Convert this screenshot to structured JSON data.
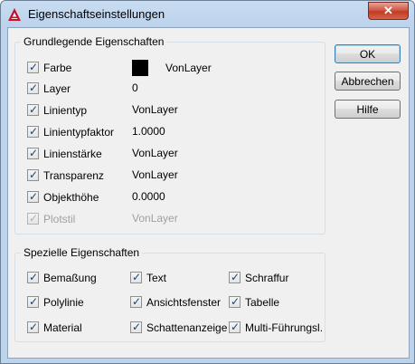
{
  "window": {
    "title": "Eigenschaftseinstellungen",
    "close_symbol": "✕"
  },
  "basic": {
    "title": "Grundlegende Eigenschaften",
    "rows": [
      {
        "label": "Farbe",
        "value": "VonLayer",
        "checked": true,
        "enabled": true
      },
      {
        "label": "Layer",
        "value": "0",
        "checked": true,
        "enabled": true
      },
      {
        "label": "Linientyp",
        "value": "VonLayer",
        "checked": true,
        "enabled": true
      },
      {
        "label": "Linientypfaktor",
        "value": "1.0000",
        "checked": true,
        "enabled": true
      },
      {
        "label": "Linienstärke",
        "value": "VonLayer",
        "checked": true,
        "enabled": true
      },
      {
        "label": "Transparenz",
        "value": "VonLayer",
        "checked": true,
        "enabled": true
      },
      {
        "label": "Objekthöhe",
        "value": "0.0000",
        "checked": true,
        "enabled": true
      },
      {
        "label": "Plotstil",
        "value": "VonLayer",
        "checked": true,
        "enabled": false
      }
    ],
    "color_swatch": "#000000"
  },
  "special": {
    "title": "Spezielle Eigenschaften",
    "items": [
      {
        "label": "Bemaßung",
        "checked": true
      },
      {
        "label": "Text",
        "checked": true
      },
      {
        "label": "Schraffur",
        "checked": true
      },
      {
        "label": "Polylinie",
        "checked": true
      },
      {
        "label": "Ansichtsfenster",
        "checked": true
      },
      {
        "label": "Tabelle",
        "checked": true
      },
      {
        "label": "Material",
        "checked": true
      },
      {
        "label": "Schattenanzeige",
        "checked": true
      },
      {
        "label": "Multi-Führungsl.",
        "checked": true
      }
    ]
  },
  "buttons": {
    "ok": "OK",
    "cancel": "Abbrechen",
    "help": "Hilfe"
  },
  "icons": {
    "app": "autocad-logo-icon",
    "close": "close-icon"
  },
  "colors": {
    "app_icon_red": "#c8102e",
    "close_red": "#c13b24"
  }
}
